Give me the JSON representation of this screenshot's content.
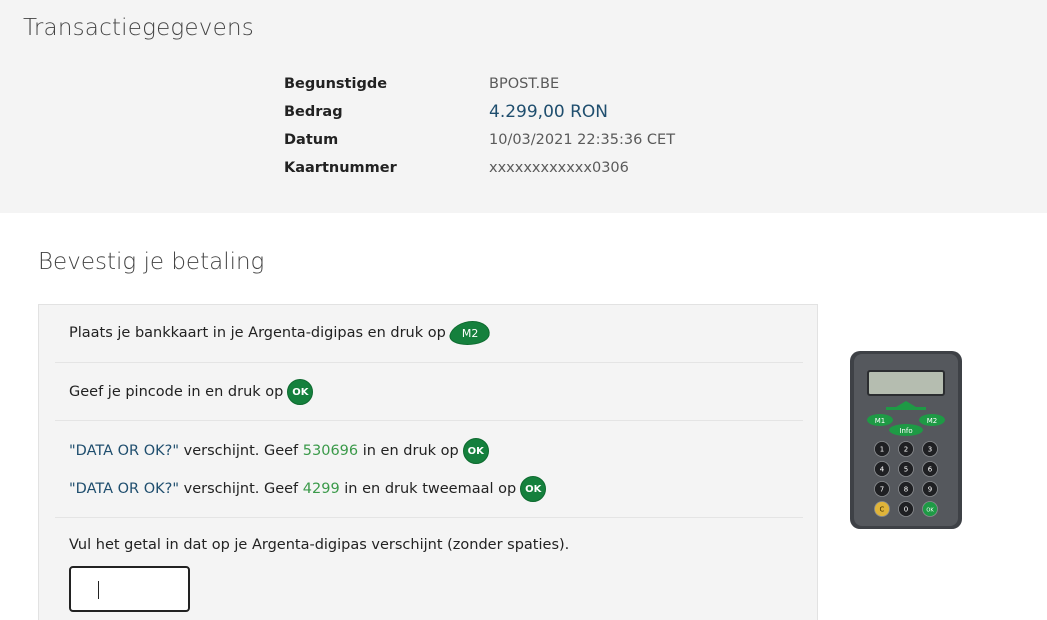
{
  "transaction": {
    "title": "Transactiegegevens",
    "rows": [
      {
        "label": "Begunstigde",
        "value": "BPOST.BE"
      },
      {
        "label": "Bedrag",
        "value": "4.299,00 RON"
      },
      {
        "label": "Datum",
        "value": "10/03/2021 22:35:36 CET"
      },
      {
        "label": "Kaartnummer",
        "value": "xxxxxxxxxxxx0306"
      }
    ]
  },
  "confirm": {
    "title": "Bevestig je betaling",
    "step1": {
      "text": "Plaats je bankkaart in je Argenta-digipas en druk op",
      "button": "M2"
    },
    "step2": {
      "text": "Geef je pincode in en druk op",
      "button": "OK"
    },
    "step3a": {
      "prompt": "\"DATA OR OK?\"",
      "mid": " verschijnt. Geef ",
      "code": "530696",
      "tail": " in en druk op",
      "button": "OK"
    },
    "step3b": {
      "prompt": "\"DATA OR OK?\"",
      "mid": " verschijnt. Geef ",
      "code": "4299",
      "tail": " in en druk tweemaal op",
      "button": "OK"
    },
    "step4": {
      "text": "Vul het getal in dat op je Argenta-digipas verschijnt (zonder spaties).",
      "input_value": ""
    }
  },
  "device": {
    "keys": [
      "1",
      "2",
      "3",
      "4",
      "5",
      "6",
      "7",
      "8",
      "9",
      "C",
      "0",
      "OK"
    ],
    "m1": "M1",
    "m2": "M2",
    "info": "Info",
    "colors": {
      "body": "#4a4d52",
      "green": "#1e9a45",
      "screen": "#b8c0b4",
      "yellow": "#e0b43a"
    }
  }
}
